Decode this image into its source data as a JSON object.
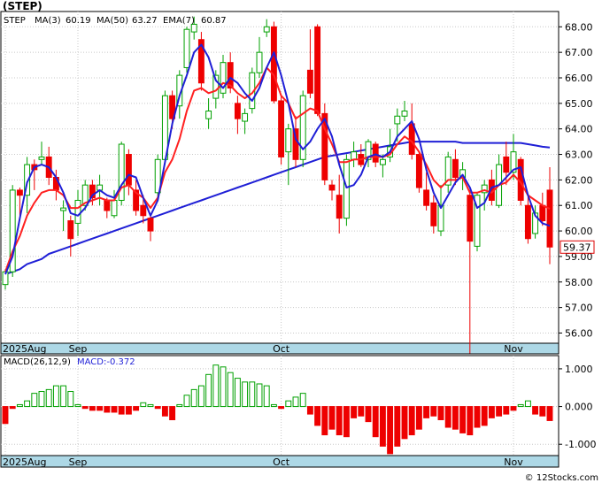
{
  "chart_data": {
    "type": "candlestick",
    "title": "(STEP)",
    "legend": {
      "symbol": "STEP",
      "ma3_label": "MA(3)",
      "ma3_value": "60.19",
      "ma50_label": "MA(50)",
      "ma50_value": "63.27",
      "ema7_label": "EMA(7)",
      "ema7_value": "60.87"
    },
    "last_price_label": "59.37",
    "last_price": 59.37,
    "price_ylim": [
      55.6,
      68.6
    ],
    "price_ticks": [
      "56.00",
      "57.00",
      "58.00",
      "59.00",
      "60.00",
      "61.00",
      "62.00",
      "63.00",
      "64.00",
      "65.00",
      "66.00",
      "67.00",
      "68.00"
    ],
    "price_tick_values": [
      56,
      57,
      58,
      59,
      60,
      61,
      62,
      63,
      64,
      65,
      66,
      67,
      68
    ],
    "x_labels": [
      "2025Aug",
      "Sep",
      "Oct",
      "Nov"
    ],
    "x_label_index": [
      0,
      10,
      38,
      70
    ],
    "candles": [
      [
        57.9,
        58.5,
        57.7,
        58.4
      ],
      [
        58.4,
        61.8,
        58.2,
        61.6
      ],
      [
        61.6,
        61.7,
        60.6,
        61.4
      ],
      [
        61.4,
        62.9,
        60.7,
        62.6
      ],
      [
        62.6,
        62.8,
        61.6,
        62.4
      ],
      [
        62.8,
        63.5,
        62.6,
        62.9
      ],
      [
        62.9,
        63.3,
        61.8,
        62.1
      ],
      [
        62.1,
        62.4,
        61.2,
        61.6
      ],
      [
        60.8,
        61.2,
        60.0,
        60.9
      ],
      [
        60.4,
        60.6,
        59.0,
        59.7
      ],
      [
        60.3,
        61.6,
        59.8,
        61.2
      ],
      [
        61.0,
        62.0,
        60.8,
        61.8
      ],
      [
        61.8,
        62.0,
        61.0,
        61.3
      ],
      [
        61.6,
        62.2,
        61.0,
        61.8
      ],
      [
        61.2,
        61.3,
        60.5,
        60.8
      ],
      [
        60.6,
        61.6,
        60.5,
        61.2
      ],
      [
        61.2,
        63.5,
        61.0,
        63.4
      ],
      [
        63.0,
        63.2,
        61.4,
        61.8
      ],
      [
        61.6,
        62.0,
        60.6,
        60.8
      ],
      [
        61.0,
        61.4,
        60.3,
        60.6
      ],
      [
        60.5,
        60.6,
        59.6,
        60.0
      ],
      [
        61.5,
        63.0,
        61.2,
        62.8
      ],
      [
        62.8,
        65.5,
        62.6,
        65.3
      ],
      [
        65.3,
        65.5,
        64.0,
        64.4
      ],
      [
        64.9,
        66.3,
        64.4,
        66.1
      ],
      [
        66.4,
        68.0,
        66.2,
        67.9
      ],
      [
        67.8,
        68.4,
        67.5,
        68.1
      ],
      [
        67.5,
        67.8,
        65.5,
        65.8
      ],
      [
        64.4,
        65.2,
        64.0,
        64.7
      ],
      [
        65.2,
        66.3,
        64.8,
        66.1
      ],
      [
        65.4,
        66.9,
        65.2,
        66.6
      ],
      [
        66.6,
        67.0,
        65.4,
        65.6
      ],
      [
        65.0,
        65.3,
        63.8,
        64.4
      ],
      [
        64.3,
        64.8,
        63.8,
        64.6
      ],
      [
        64.8,
        66.4,
        64.6,
        66.2
      ],
      [
        66.2,
        67.6,
        66.0,
        67.0
      ],
      [
        67.8,
        68.3,
        67.6,
        68.0
      ],
      [
        68.0,
        68.2,
        65.0,
        65.1
      ],
      [
        65.1,
        65.3,
        62.6,
        62.9
      ],
      [
        63.1,
        64.2,
        61.8,
        64.0
      ],
      [
        64.0,
        64.5,
        62.5,
        62.8
      ],
      [
        62.8,
        65.5,
        62.5,
        65.3
      ],
      [
        66.3,
        67.9,
        65.2,
        65.4
      ],
      [
        68.0,
        68.1,
        64.5,
        64.6
      ],
      [
        64.6,
        65.0,
        61.8,
        62.0
      ],
      [
        61.8,
        62.0,
        61.2,
        61.6
      ],
      [
        61.4,
        62.2,
        59.9,
        60.5
      ],
      [
        60.5,
        63.0,
        60.2,
        62.8
      ],
      [
        62.8,
        63.5,
        62.5,
        63.1
      ],
      [
        63.0,
        63.4,
        62.5,
        62.6
      ],
      [
        62.8,
        63.6,
        62.5,
        63.5
      ],
      [
        63.4,
        63.5,
        62.5,
        62.7
      ],
      [
        62.6,
        63.0,
        62.1,
        62.8
      ],
      [
        62.9,
        64.0,
        62.7,
        63.3
      ],
      [
        64.2,
        64.8,
        63.5,
        64.5
      ],
      [
        64.5,
        65.1,
        64.3,
        64.7
      ],
      [
        64.2,
        65.0,
        62.8,
        63.0
      ],
      [
        63.0,
        63.1,
        61.5,
        61.7
      ],
      [
        61.6,
        62.3,
        60.8,
        61.0
      ],
      [
        61.1,
        61.4,
        59.9,
        60.2
      ],
      [
        60.0,
        61.8,
        59.8,
        61.0
      ],
      [
        61.8,
        63.1,
        61.5,
        62.9
      ],
      [
        62.8,
        63.2,
        61.8,
        62.1
      ],
      [
        62.1,
        62.7,
        61.6,
        62.4
      ],
      [
        61.4,
        61.6,
        55.2,
        59.6
      ],
      [
        59.4,
        61.5,
        59.2,
        61.4
      ],
      [
        61.5,
        62.0,
        60.8,
        61.8
      ],
      [
        62.0,
        62.4,
        61.0,
        61.2
      ],
      [
        61.0,
        63.0,
        60.9,
        62.6
      ],
      [
        62.9,
        63.5,
        61.8,
        62.3
      ],
      [
        62.3,
        63.8,
        62.0,
        63.1
      ],
      [
        62.8,
        62.9,
        61.0,
        61.2
      ],
      [
        61.0,
        61.4,
        59.5,
        59.7
      ],
      [
        59.9,
        61.0,
        59.7,
        60.7
      ],
      [
        61.0,
        61.5,
        60.2,
        60.4
      ],
      [
        61.6,
        62.5,
        58.7,
        59.37
      ]
    ],
    "ma3": [
      58.3,
      59.0,
      60.5,
      61.9,
      62.5,
      62.6,
      62.5,
      62.1,
      61.5,
      60.7,
      60.6,
      60.9,
      61.4,
      61.6,
      61.4,
      61.3,
      61.8,
      62.2,
      62.1,
      61.3,
      60.6,
      61.2,
      62.7,
      64.2,
      65.3,
      66.1,
      67.0,
      67.3,
      66.8,
      65.9,
      65.6,
      66.0,
      65.8,
      65.4,
      65.1,
      65.6,
      66.4,
      67.0,
      66.1,
      65.0,
      63.6,
      63.2,
      63.5,
      64.0,
      64.4,
      63.7,
      62.6,
      61.7,
      61.8,
      62.2,
      62.9,
      63.0,
      62.9,
      63.1,
      63.7,
      64.0,
      64.3,
      63.6,
      62.4,
      61.5,
      60.9,
      61.4,
      61.9,
      62.2,
      61.7,
      60.9,
      61.1,
      61.7,
      61.8,
      62.1,
      62.4,
      62.5,
      61.4,
      60.6,
      60.3,
      60.2
    ],
    "ema7": [
      58.4,
      59.2,
      59.8,
      60.6,
      61.1,
      61.5,
      61.6,
      61.6,
      61.4,
      60.9,
      60.9,
      61.1,
      61.2,
      61.3,
      61.2,
      61.2,
      61.7,
      61.8,
      61.5,
      61.3,
      60.9,
      61.3,
      62.3,
      62.8,
      63.6,
      64.7,
      65.5,
      65.6,
      65.4,
      65.5,
      65.8,
      65.7,
      65.4,
      65.2,
      65.4,
      65.8,
      66.4,
      66.1,
      65.3,
      65.0,
      64.4,
      64.6,
      64.8,
      64.7,
      64.0,
      63.4,
      62.7,
      62.7,
      62.8,
      62.8,
      62.9,
      62.9,
      62.9,
      63.0,
      63.4,
      63.7,
      63.5,
      63.1,
      62.6,
      62.0,
      61.7,
      62.0,
      62.0,
      62.1,
      61.5,
      61.5,
      61.6,
      61.5,
      61.8,
      61.9,
      62.2,
      61.9,
      61.4,
      61.2,
      61.0,
      60.87
    ],
    "ma50": [
      58.3,
      58.4,
      58.5,
      58.7,
      58.8,
      58.9,
      59.1,
      59.2,
      59.3,
      59.4,
      59.5,
      59.6,
      59.7,
      59.8,
      59.9,
      60.0,
      60.1,
      60.2,
      60.3,
      60.4,
      60.5,
      60.6,
      60.7,
      60.8,
      60.9,
      61.0,
      61.1,
      61.2,
      61.3,
      61.4,
      61.5,
      61.6,
      61.7,
      61.8,
      61.9,
      62.0,
      62.1,
      62.2,
      62.3,
      62.4,
      62.5,
      62.6,
      62.7,
      62.8,
      62.9,
      62.95,
      63.0,
      63.05,
      63.1,
      63.15,
      63.2,
      63.25,
      63.3,
      63.35,
      63.4,
      63.45,
      63.5,
      63.5,
      63.5,
      63.5,
      63.5,
      63.5,
      63.5,
      63.45,
      63.45,
      63.45,
      63.45,
      63.45,
      63.45,
      63.45,
      63.45,
      63.45,
      63.4,
      63.35,
      63.3,
      63.27
    ],
    "macd": {
      "label": "MACD(26,12,9)",
      "value_label": "MACD:-0.372",
      "ylim": [
        -1.3,
        1.35
      ],
      "ticks": [
        "1.000",
        "0.000",
        "-1.000"
      ],
      "tick_values": [
        1,
        0,
        -1
      ],
      "hist": [
        -0.45,
        -0.05,
        0.05,
        0.15,
        0.35,
        0.4,
        0.45,
        0.55,
        0.55,
        0.4,
        0.05,
        -0.05,
        -0.1,
        -0.1,
        -0.15,
        -0.15,
        -0.2,
        -0.2,
        -0.1,
        0.1,
        0.05,
        -0.05,
        -0.25,
        -0.35,
        0.05,
        0.3,
        0.45,
        0.55,
        0.85,
        1.1,
        1.05,
        0.9,
        0.75,
        0.65,
        0.65,
        0.6,
        0.55,
        0.05,
        -0.05,
        0.15,
        0.25,
        0.35,
        -0.2,
        -0.5,
        -0.75,
        -0.6,
        -0.75,
        -0.8,
        -0.3,
        -0.25,
        -0.4,
        -0.8,
        -1.05,
        -1.25,
        -1.05,
        -0.85,
        -0.75,
        -0.6,
        -0.3,
        -0.25,
        -0.35,
        -0.55,
        -0.6,
        -0.7,
        -0.75,
        -0.55,
        -0.5,
        -0.3,
        -0.25,
        -0.2,
        -0.1,
        0.05,
        0.15,
        -0.2,
        -0.25,
        -0.372
      ]
    }
  },
  "footer": {
    "copyright": "© 12Stocks.com"
  },
  "colors": {
    "up": "#00a000",
    "down": "#ee0000",
    "ma3": "#dd0000",
    "ma50": "#1f1fd6",
    "ema7": "#ff2020",
    "axis_band": "#add8e6",
    "label_box": "#dd0000"
  }
}
